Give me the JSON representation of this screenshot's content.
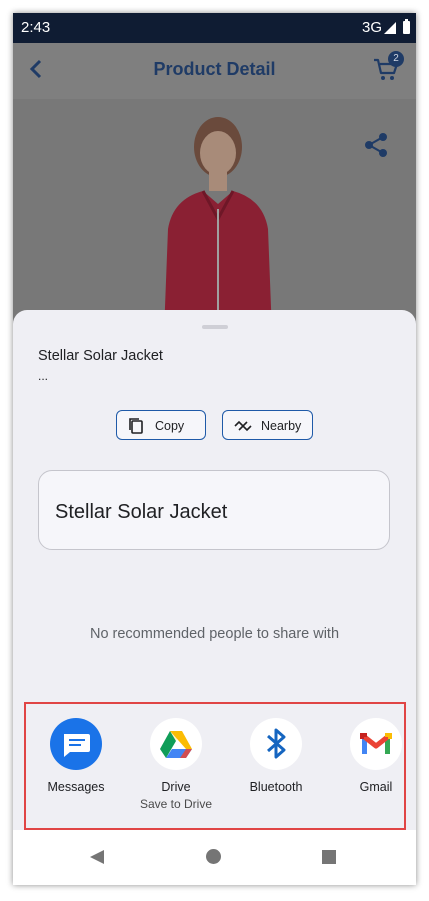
{
  "status_bar": {
    "time": "2:43",
    "network": "3G"
  },
  "app_bar": {
    "title": "Product Detail",
    "cart_count": "2"
  },
  "share_sheet": {
    "title": "Stellar Solar Jacket",
    "subtitle": "...",
    "chips": {
      "copy": "Copy",
      "nearby": "Nearby"
    },
    "preview_text": "Stellar Solar Jacket",
    "no_people_text": "No recommended people to share with"
  },
  "share_targets": [
    {
      "label": "Messages",
      "icon": "messages-icon"
    },
    {
      "label": "Drive",
      "sub": "Save to Drive",
      "icon": "google-drive-icon"
    },
    {
      "label": "Bluetooth",
      "icon": "bluetooth-icon"
    },
    {
      "label": "Gmail",
      "icon": "gmail-icon"
    }
  ],
  "colors": {
    "highlight_box": "#e04545",
    "brand_navy": "#1f3b66",
    "chip_border": "#1f5aa8"
  }
}
